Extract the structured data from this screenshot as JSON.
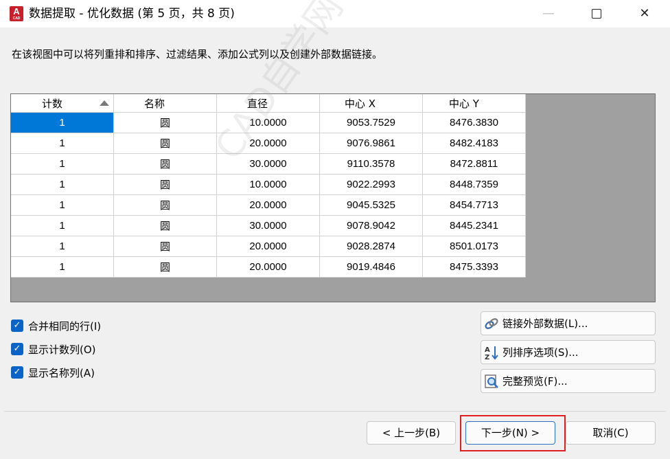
{
  "window": {
    "title": "数据提取 - 优化数据 (第 5 页，共 8 页)",
    "icon_text": "A",
    "icon_subtext": "CAD",
    "minimize": "—",
    "close": "✕"
  },
  "description": "在该视图中可以将列重排和排序、过滤结果、添加公式列以及创建外部数据链接。",
  "grid": {
    "columns": [
      "计数",
      "名称",
      "直径",
      "中心 X",
      "中心 Y"
    ],
    "rows": [
      [
        "1",
        "圆",
        "10.0000",
        "9053.7529",
        "8476.3830"
      ],
      [
        "1",
        "圆",
        "20.0000",
        "9076.9861",
        "8482.4183"
      ],
      [
        "1",
        "圆",
        "30.0000",
        "9110.3578",
        "8472.8811"
      ],
      [
        "1",
        "圆",
        "10.0000",
        "9022.2993",
        "8448.7359"
      ],
      [
        "1",
        "圆",
        "20.0000",
        "9045.5325",
        "8454.7713"
      ],
      [
        "1",
        "圆",
        "30.0000",
        "9078.9042",
        "8445.2341"
      ],
      [
        "1",
        "圆",
        "20.0000",
        "9028.2874",
        "8501.0173"
      ],
      [
        "1",
        "圆",
        "20.0000",
        "9019.4846",
        "8475.3393"
      ]
    ]
  },
  "options": {
    "merge_rows": "合并相同的行(I)",
    "show_count": "显示计数列(O)",
    "show_name": "显示名称列(A)",
    "checkmark": "✓"
  },
  "side_buttons": {
    "link_external": "链接外部数据(L)...",
    "sort_options": "列排序选项(S)...",
    "full_preview": "完整预览(F)..."
  },
  "nav": {
    "back": "< 上一步(B)",
    "next": "下一步(N) >",
    "cancel": "取消(C)"
  },
  "watermark": "CAD自学网 www.cadzxw.com"
}
